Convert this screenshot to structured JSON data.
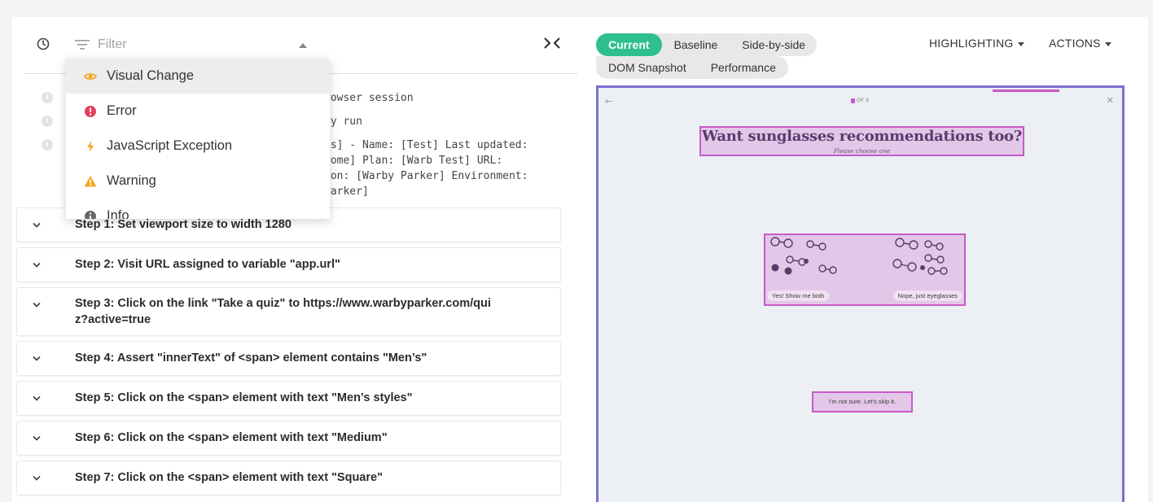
{
  "left_toolbar": {
    "filter_placeholder": "Filter",
    "icons": {
      "history": "clock-icon",
      "filter": "filter-lines-icon",
      "collapse": "collapse-arrows-icon"
    }
  },
  "log_lines": [
    "rowser session",
    "ey run",
    "ls] - Name: [Test] Last updated:",
    "rome] Plan: [Warb Test] URL:",
    "ion: [Warby Parker] Environment:",
    " Parker]"
  ],
  "filter_dropdown": {
    "items": [
      {
        "label": "Visual Change",
        "icon": "eye-icon",
        "color": "#f5a623",
        "selected": true
      },
      {
        "label": "Error",
        "icon": "error-circle-icon",
        "color": "#e53e5c"
      },
      {
        "label": "JavaScript Exception",
        "icon": "lightning-icon",
        "color": "#f5a623"
      },
      {
        "label": "Warning",
        "icon": "warning-triangle-icon",
        "color": "#f5a623"
      },
      {
        "label": "Info",
        "icon": "info-circle-icon",
        "color": "#666666"
      }
    ]
  },
  "steps": [
    {
      "label": "Step 1: Set viewport size to width 1280"
    },
    {
      "label": "Step 2: Visit URL assigned to variable \"app.url\""
    },
    {
      "label": "Step 3: Click on the link \"Take a quiz\" to https://www.warbyparker.com/quiz?active=true"
    },
    {
      "label": "Step 4: Assert \"innerText\" of <span> element contains \"Men’s\""
    },
    {
      "label": "Step 5: Click on the <span> element with text \"Men’s styles\""
    },
    {
      "label": "Step 6: Click on the <span> element with text \"Medium\""
    },
    {
      "label": "Step 7: Click on the <span> element with text \"Square\""
    }
  ],
  "view_tabs": {
    "row1": [
      "Current",
      "Baseline",
      "Side-by-side"
    ],
    "row2": [
      "DOM Snapshot",
      "Performance"
    ],
    "active": "Current",
    "active_color": "#2dbf8f"
  },
  "menus": {
    "highlighting": "HIGHLIGHTING",
    "actions": "ACTIONS"
  },
  "snapshot": {
    "page_indicator": "OF 8",
    "heading": "Want sunglasses recommendations too?",
    "subheading": "Please choose one",
    "option_left": "Yes! Show me both",
    "option_right": "Nope, just eyeglasses",
    "skip": "I'm not sure. Let's skip it.",
    "highlight_color": "#c75ac9",
    "frame_color": "#7b6fd0"
  }
}
